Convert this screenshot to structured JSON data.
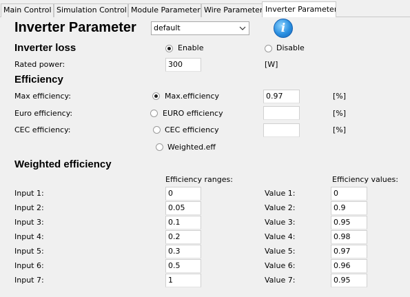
{
  "tabs": [
    {
      "label": "Main Control"
    },
    {
      "label": "Simulation Control"
    },
    {
      "label": "Module Parameter"
    },
    {
      "label": "Wire Parameter"
    },
    {
      "label": "Inverter Parameter"
    }
  ],
  "header": {
    "title": "Inverter Parameter",
    "preset_select_value": "default",
    "info_icon": "i"
  },
  "loss": {
    "heading": "Inverter loss",
    "enable_label": "Enable",
    "disable_label": "Disable",
    "selected": "Enable",
    "rated_power_label": "Rated power:",
    "rated_power_value": "300",
    "rated_power_unit": "[W]"
  },
  "efficiency": {
    "heading": "Efficiency",
    "rows": [
      {
        "label": "Max efficiency:",
        "option": "Max.efficiency",
        "value": "0.97",
        "unit": "[%]"
      },
      {
        "label": "Euro efficiency:",
        "option": "EURO efficiency",
        "value": "",
        "unit": "[%]"
      },
      {
        "label": "CEC efficiency:",
        "option": "CEC efficiency",
        "value": "",
        "unit": "[%]"
      }
    ],
    "weighted_option": "Weighted.eff",
    "selected_option": "Max.efficiency"
  },
  "weighted": {
    "heading": "Weighted efficiency",
    "ranges_header": "Efficiency ranges:",
    "values_header": "Efficiency values:",
    "rows": [
      {
        "input_label": "Input 1:",
        "range": "0",
        "value_label": "Value 1:",
        "value": "0"
      },
      {
        "input_label": "Input 2:",
        "range": "0.05",
        "value_label": "Value 2:",
        "value": "0.9"
      },
      {
        "input_label": "Input 3:",
        "range": "0.1",
        "value_label": "Value 3:",
        "value": "0.95"
      },
      {
        "input_label": "Input 4:",
        "range": "0.2",
        "value_label": "Value 4:",
        "value": "0.98"
      },
      {
        "input_label": "Input 5:",
        "range": "0.3",
        "value_label": "Value 5:",
        "value": "0.97"
      },
      {
        "input_label": "Input 6:",
        "range": "0.5",
        "value_label": "Value 6:",
        "value": "0.96"
      },
      {
        "input_label": "Input 7:",
        "range": "1",
        "value_label": "Value 7:",
        "value": "0.95"
      }
    ]
  },
  "colors": {
    "background": "#f0f0f0",
    "active_tab": "#ffffff",
    "info_icon": "#2a8fe0"
  }
}
